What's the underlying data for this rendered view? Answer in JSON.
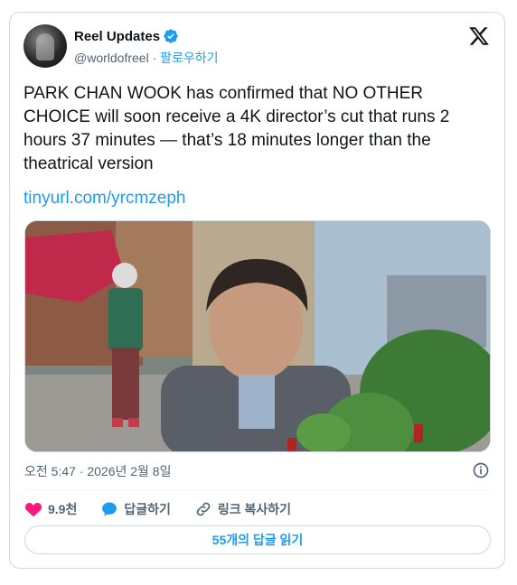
{
  "author": {
    "name": "Reel Updates",
    "handle": "@worldofreel",
    "separator": "·",
    "follow_label": "팔로우하기"
  },
  "tweet": {
    "text": "PARK CHAN WOOK has confirmed that NO OTHER CHOICE will soon receive a 4K director’s cut that runs 2 hours 37 minutes — that’s 18 minutes longer than the theatrical version",
    "link": "tinyurl.com/yrcmzeph",
    "timestamp": "오전 5:47 · 2026년 2월 8일"
  },
  "actions": {
    "likes": "9.9천",
    "reply_label": "답글하기",
    "copy_link_label": "링크 복사하기"
  },
  "replies_button": "55개의 답글 읽기",
  "colors": {
    "accent": "#1d9bf0",
    "like": "#f91880",
    "text": "#0f1419",
    "muted": "#536471",
    "border": "#cfd9de"
  },
  "icons": [
    "verified-badge-icon",
    "x-logo-icon",
    "info-icon",
    "heart-icon",
    "reply-bubble-icon",
    "link-icon"
  ]
}
